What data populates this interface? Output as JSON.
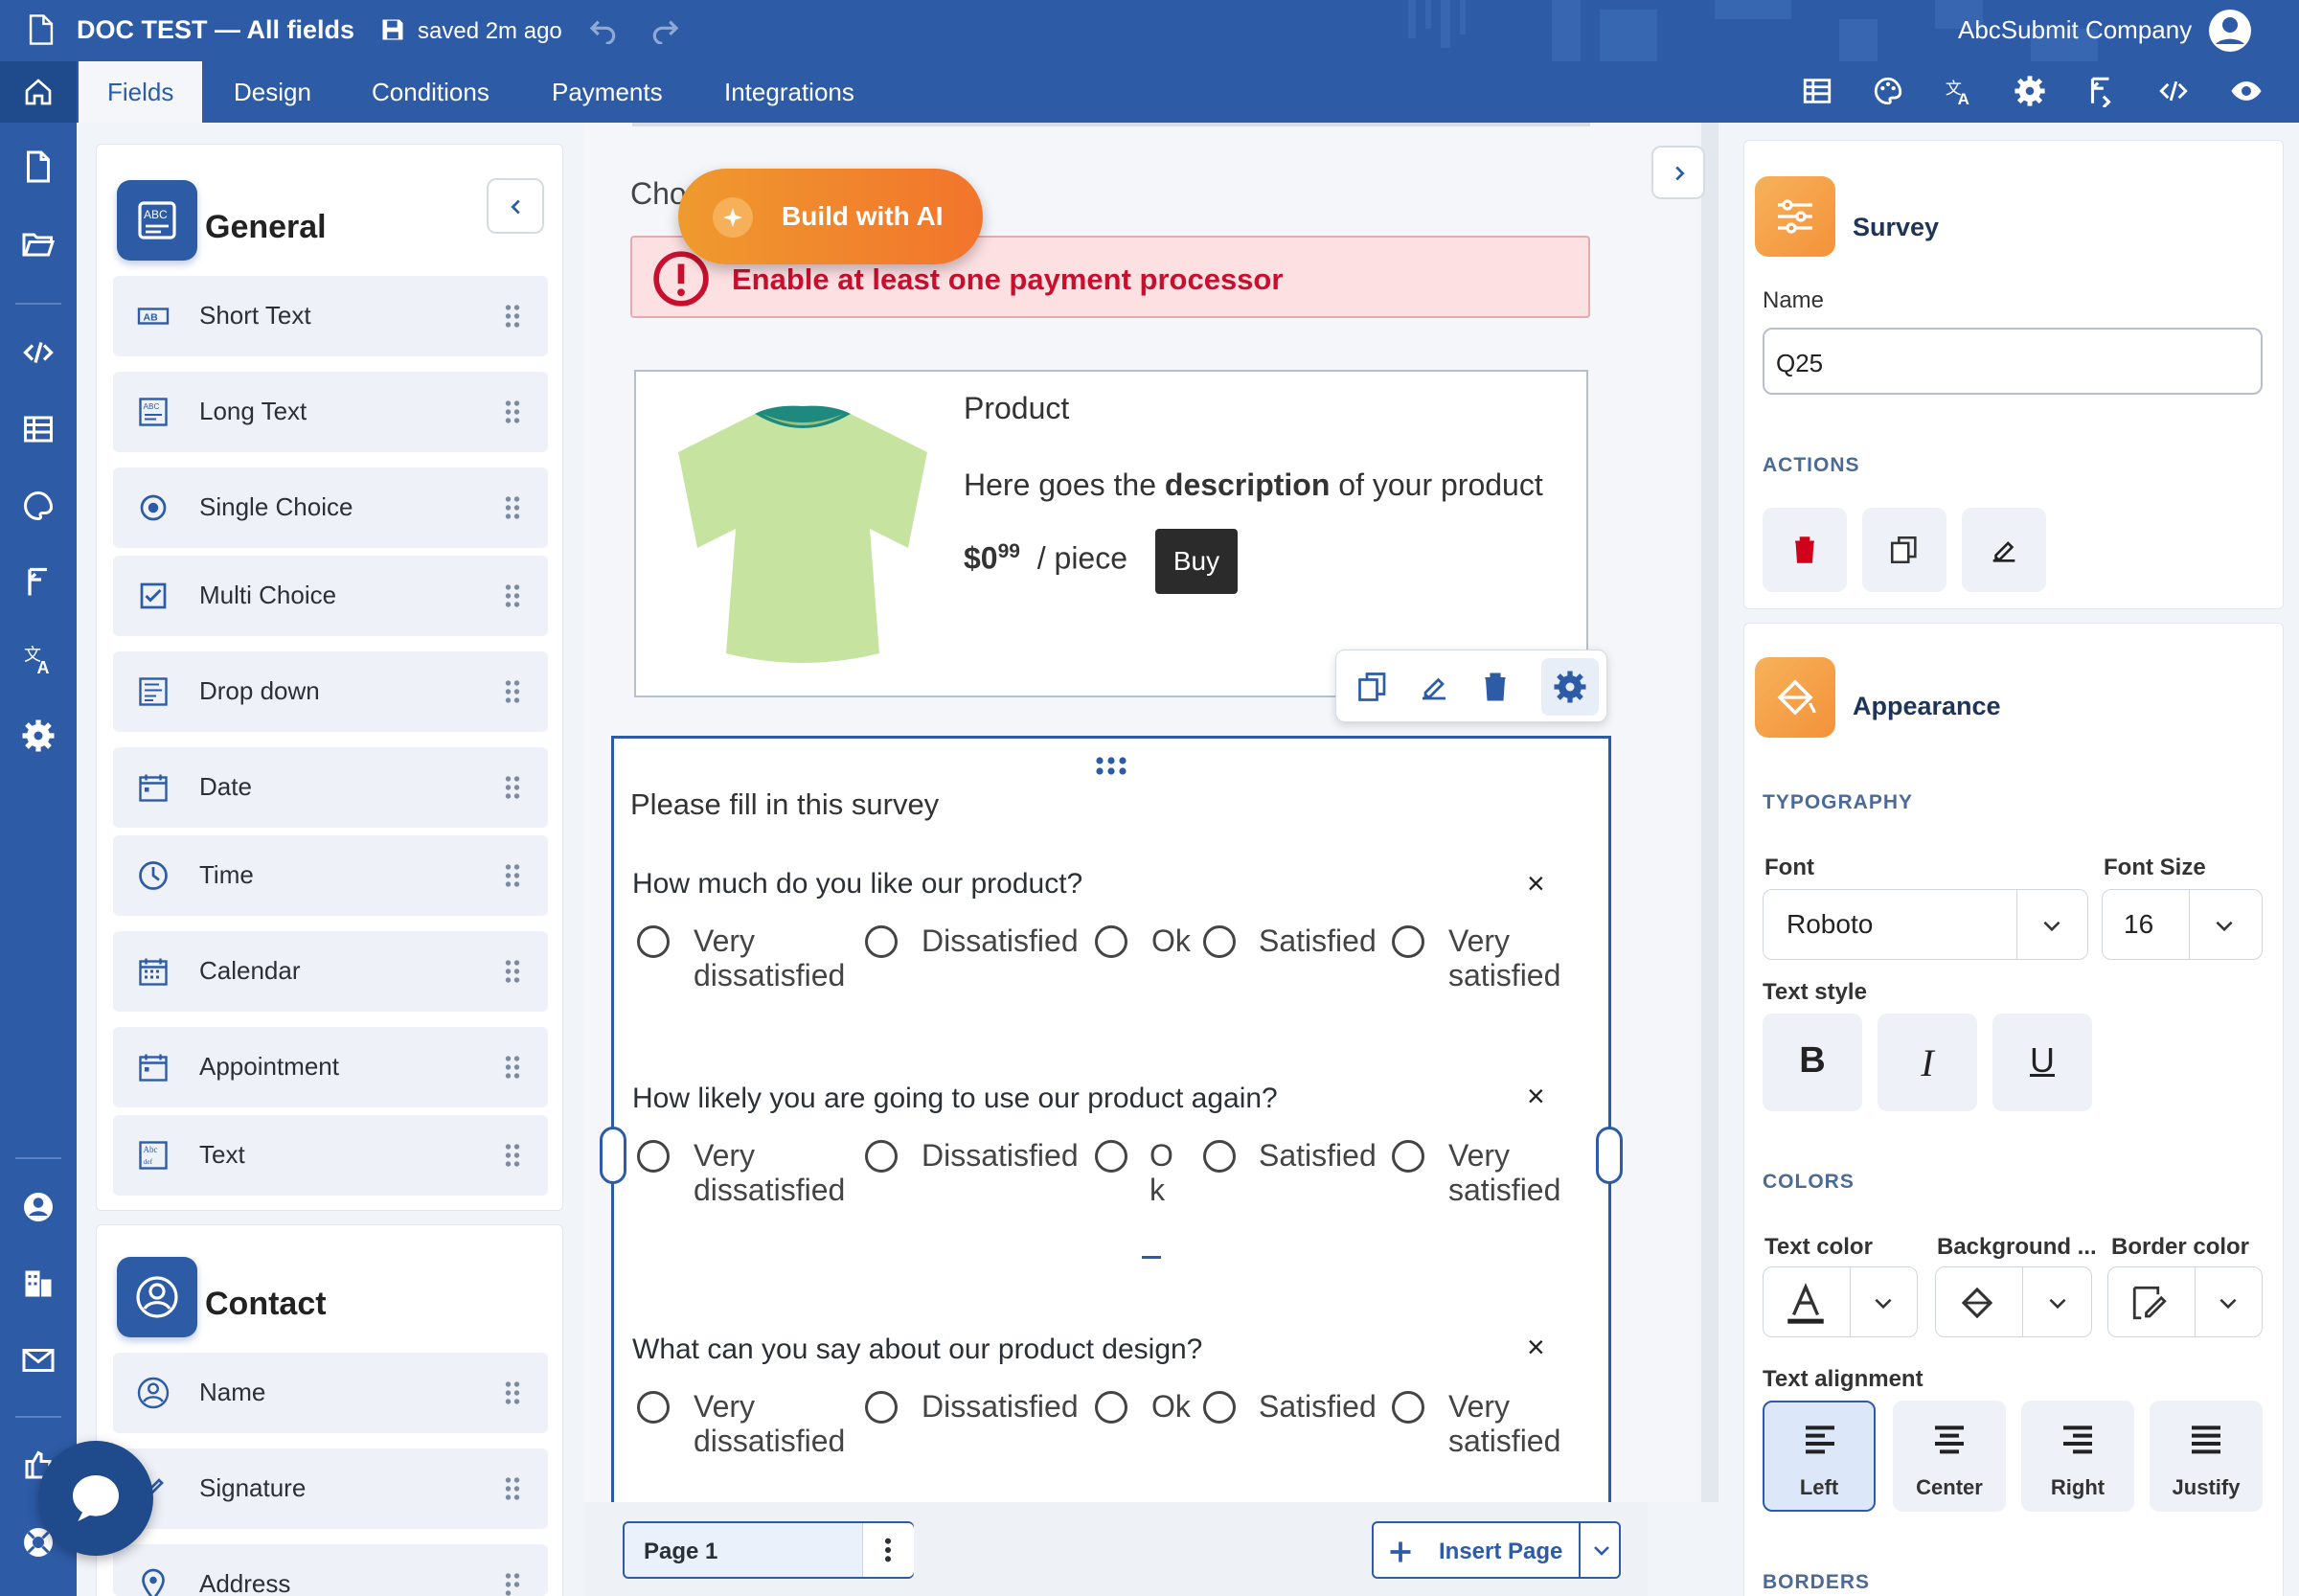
{
  "header": {
    "title": "DOC TEST — All fields",
    "saved": "saved 2m ago",
    "company": "AbcSubmit Company"
  },
  "tabs": [
    "Fields",
    "Design",
    "Conditions",
    "Payments",
    "Integrations"
  ],
  "left": {
    "general": {
      "title": "General",
      "items": [
        "Short Text",
        "Long Text",
        "Single Choice",
        "Multi Choice",
        "Drop down",
        "Date",
        "Time",
        "Calendar",
        "Appointment",
        "Text"
      ]
    },
    "contact": {
      "title": "Contact",
      "items": [
        "Name",
        "Signature",
        "Address"
      ]
    }
  },
  "canvas": {
    "partial_label": "Cho",
    "ai_button": "Build with AI",
    "alert": "Enable at least one payment processor",
    "product": {
      "title": "Product",
      "desc_pre": "Here goes the ",
      "desc_bold": "description",
      "desc_post": " of your product",
      "price_main": "$0",
      "price_sup": "99",
      "price_unit": "/ piece",
      "buy": "Buy"
    },
    "survey": {
      "title": "Please fill in this survey",
      "questions": [
        {
          "text": "How much do you like our product?",
          "options": [
            "Very dissatisfied",
            "Dissatisfied",
            "Ok",
            "Satisfied",
            "Very satisfied"
          ]
        },
        {
          "text": "How likely you are going to use our product again?",
          "options": [
            "Very dissatisfied",
            "Dissatisfied",
            "O k",
            "Satisfied",
            "Very satisfied"
          ]
        },
        {
          "text": "What can you say about our product design?",
          "options": [
            "Very dissatisfied",
            "Dissatisfied",
            "Ok",
            "Satisfied",
            "Very satisfied"
          ]
        }
      ],
      "remove": "×"
    },
    "page_label": "Page 1",
    "insert_page": "Insert Page"
  },
  "right": {
    "survey": {
      "title": "Survey",
      "name_label": "Name",
      "name_value": "Q25",
      "actions_caption": "ACTIONS"
    },
    "appearance": {
      "title": "Appearance",
      "typography_caption": "TYPOGRAPHY",
      "font_label": "Font",
      "font_value": "Roboto",
      "size_label": "Font Size",
      "size_value": "16",
      "text_style_label": "Text style",
      "style_b": "B",
      "style_i": "I",
      "style_u": "U",
      "colors_caption": "COLORS",
      "text_color_label": "Text color",
      "background_label": "Background ...",
      "border_color_label": "Border color",
      "alignment_label": "Text alignment",
      "align": [
        "Left",
        "Center",
        "Right",
        "Justify"
      ],
      "borders_caption": "BORDERS"
    }
  },
  "colors": {
    "brand": "#2d5ba6",
    "accent_orange": "#f3923a",
    "alert_bg": "#fde0e2",
    "alert_text": "#c8102e"
  }
}
